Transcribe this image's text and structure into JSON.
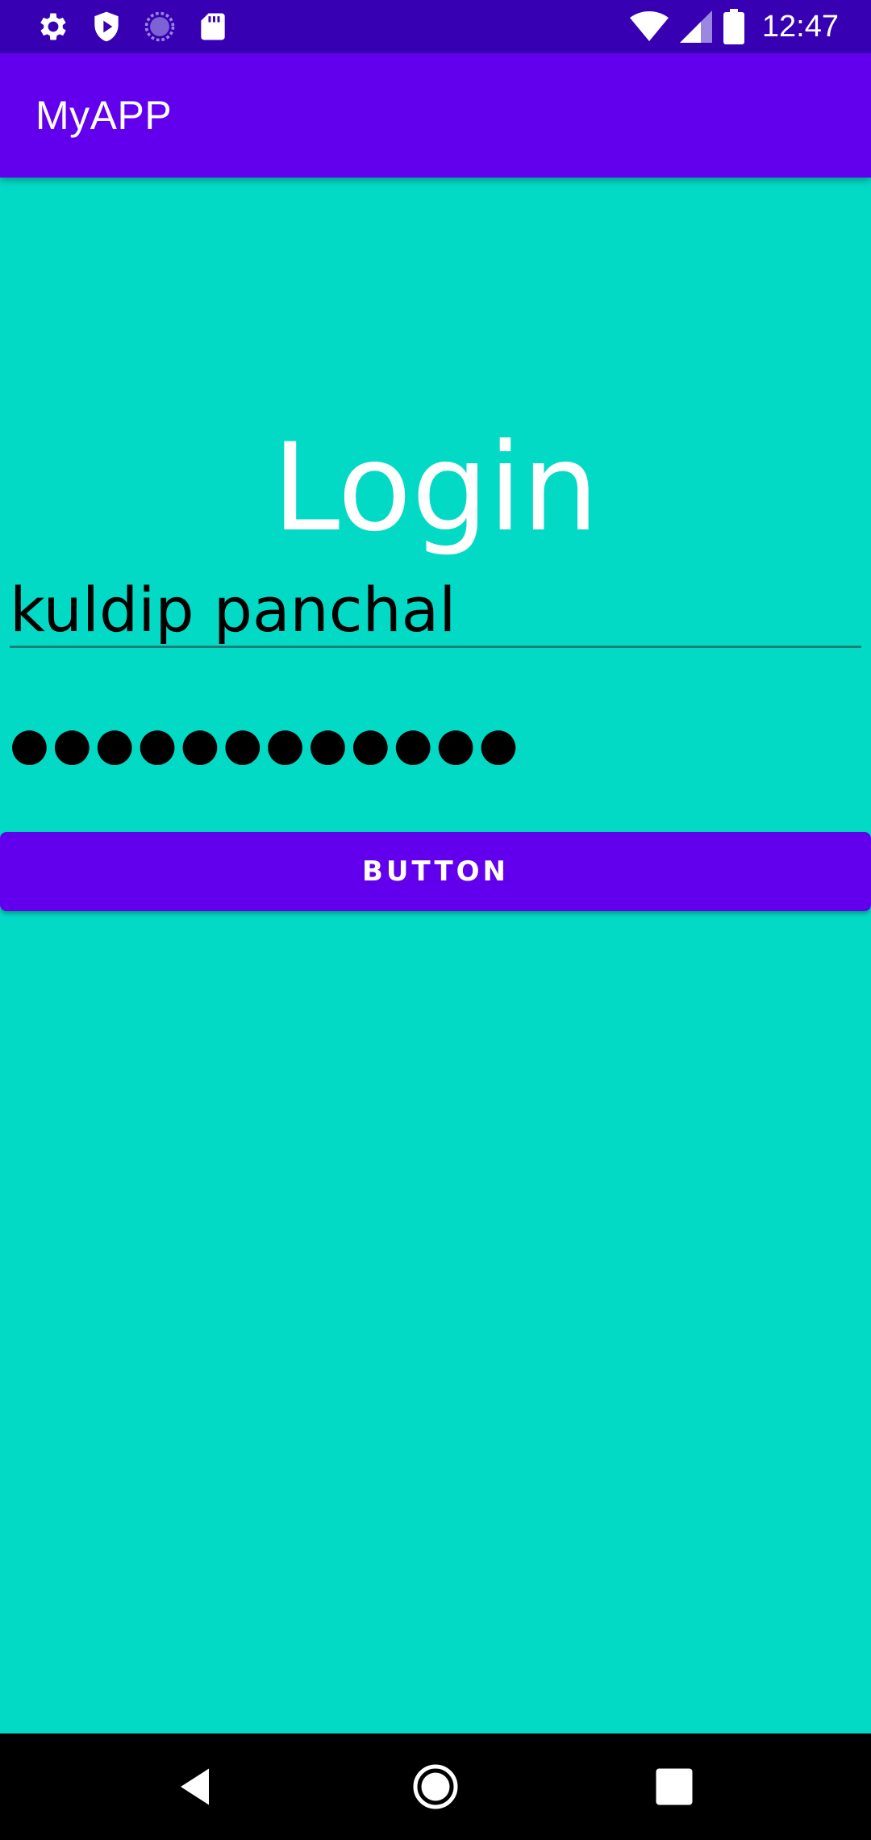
{
  "status_bar": {
    "time": "12:47",
    "icons": [
      "settings-icon",
      "shield-play-icon",
      "sync-circle-icon",
      "sd-card-icon",
      "wifi-icon",
      "signal-icon",
      "battery-icon"
    ]
  },
  "app_bar": {
    "title": "MyAPP"
  },
  "login": {
    "heading": "Login",
    "username_value": "kuldip panchal",
    "password_value": "●●●●●●●●●●●●",
    "button_label": "BUTTON"
  },
  "nav_bar": {
    "icons": [
      "back-icon",
      "home-icon",
      "recents-icon"
    ]
  },
  "colors": {
    "status_bar": "#3700B3",
    "app_bar": "#6200EE",
    "background": "#03DAC5",
    "button": "#6200EE",
    "nav_bar": "#000000"
  }
}
